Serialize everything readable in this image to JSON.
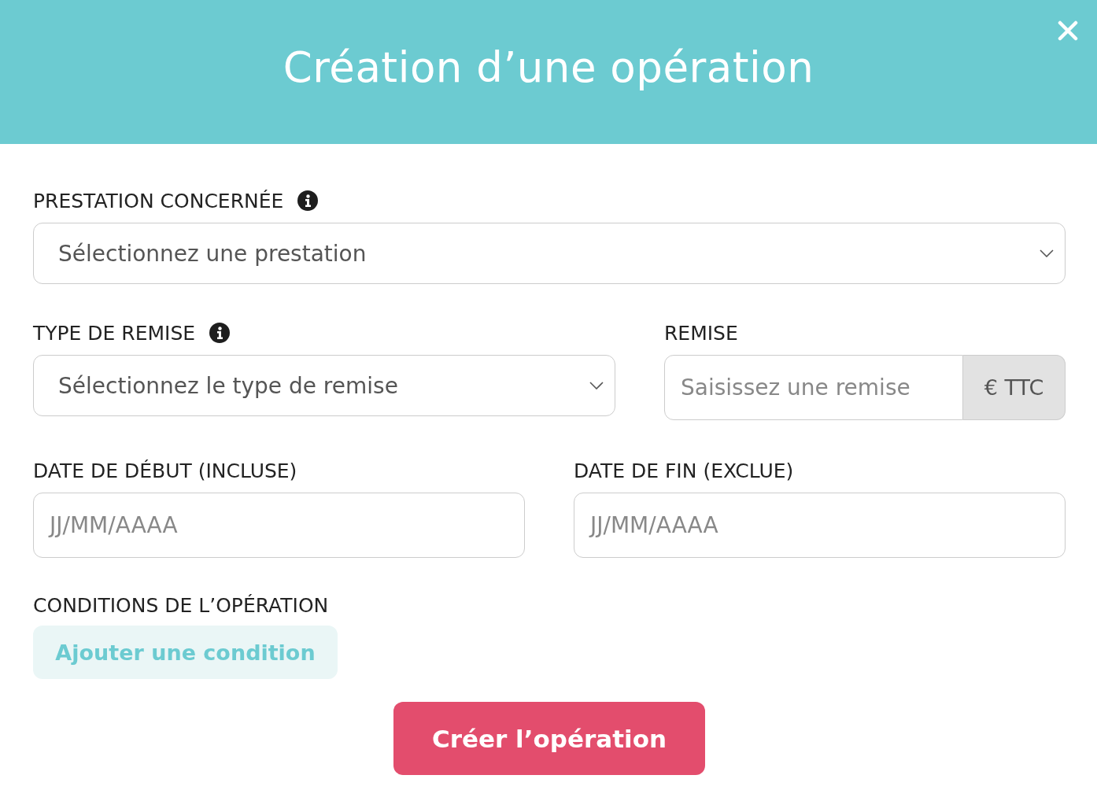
{
  "dialog": {
    "title": "Création d’une opération"
  },
  "rows": [
    [
      {
        "kind": "select",
        "label": "PRESTATION CONCERNÉE",
        "info": true,
        "placeholder": "Sélectionnez une prestation"
      }
    ],
    [
      {
        "kind": "select",
        "label": "TYPE DE REMISE",
        "info": true,
        "placeholder": "Sélectionnez le type de remise"
      },
      {
        "kind": "addon",
        "label": "REMISE",
        "info": false,
        "placeholder": "Saisissez une remise",
        "addon": "€ TTC"
      }
    ],
    [
      {
        "kind": "input",
        "label": "DATE DE DÉBUT (INCLUSE)",
        "info": false,
        "placeholder": "JJ/MM/AAAA"
      },
      {
        "kind": "input",
        "label": "DATE DE FIN (EXCLUE)",
        "info": false,
        "placeholder": "JJ/MM/AAAA"
      }
    ]
  ],
  "conditions": {
    "label": "CONDITIONS DE L’OPÉRATION",
    "button": "Ajouter une condition"
  },
  "submit": "Créer l’opération"
}
